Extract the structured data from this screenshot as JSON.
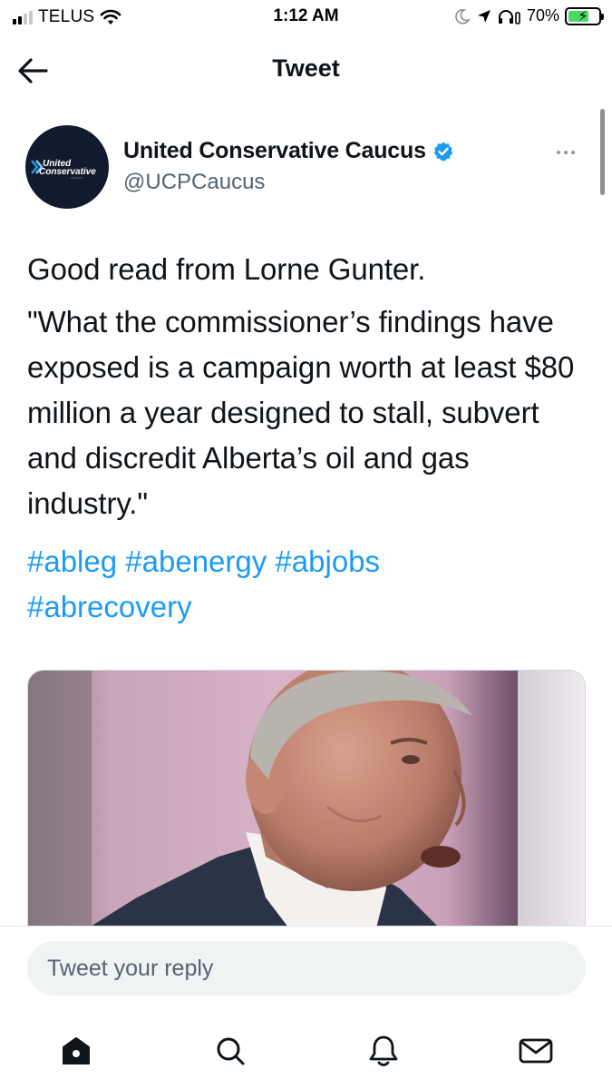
{
  "status_bar": {
    "carrier": "TELUS",
    "time": "1:12 AM",
    "battery_percent": "70%",
    "battery_level": 0.7,
    "battery_color": "#4cd964",
    "icons": [
      "signal-icon",
      "wifi-icon",
      "moon-icon",
      "location-arrow-icon",
      "headphones-icon",
      "battery-charging-icon"
    ]
  },
  "header": {
    "title": "Tweet",
    "back_icon": "back-arrow-icon"
  },
  "tweet": {
    "author": {
      "display_name": "United Conservative Caucus",
      "handle": "@UCPCaucus",
      "verified": true,
      "avatar_logo_text": "United Conservative"
    },
    "text_line1": "Good read from Lorne Gunter.",
    "text_quote": "\"What the commissioner’s findings have exposed is a campaign worth at least $80 million a year designed to stall, subvert and discredit Alberta’s oil and gas industry.\"",
    "hashtags": [
      "#ableg",
      "#abenergy",
      "#abjobs",
      "#abrecovery"
    ],
    "media": {
      "type": "photo"
    }
  },
  "reply": {
    "placeholder": "Tweet your reply"
  },
  "bottom_nav": {
    "items": [
      "home-icon",
      "search-icon",
      "notifications-icon",
      "messages-icon"
    ]
  },
  "colors": {
    "link": "#1d9bf0",
    "text": "#0f1419",
    "secondary_text": "#536471",
    "verified_badge": "#1d9bf0",
    "avatar_bg": "#121a2e"
  }
}
